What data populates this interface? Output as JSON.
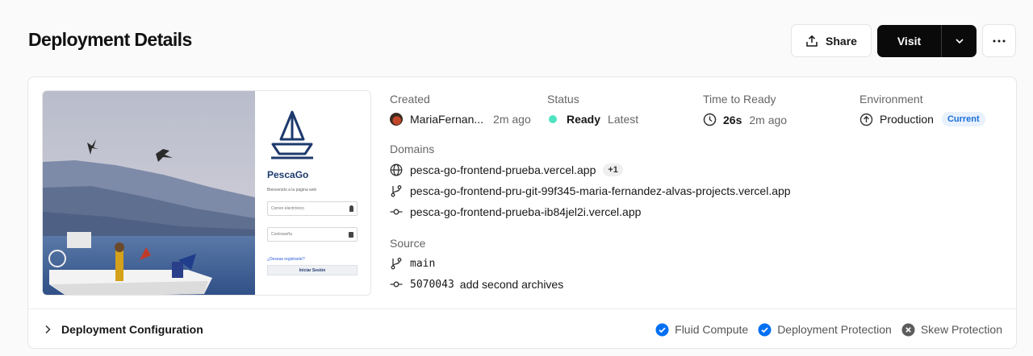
{
  "header": {
    "title": "Deployment Details",
    "share_label": "Share",
    "visit_label": "Visit"
  },
  "preview": {
    "app_name": "PescaGo",
    "welcome": "Bienvenido a la página web",
    "email_placeholder": "Correo electrónico",
    "password_placeholder": "Contraseña",
    "register_link": "¿Deseas registrarte?",
    "login_button": "Iniciar Sesión"
  },
  "info": {
    "created": {
      "label": "Created",
      "user": "MariaFernan...",
      "time": "2m ago"
    },
    "status": {
      "label": "Status",
      "value": "Ready",
      "tag": "Latest",
      "color": "#50e3c2"
    },
    "ready": {
      "label": "Time to Ready",
      "duration": "26s",
      "time": "2m ago"
    },
    "environment": {
      "label": "Environment",
      "value": "Production",
      "badge": "Current"
    }
  },
  "domains": {
    "label": "Domains",
    "primary": "pesca-go-frontend-prueba.vercel.app",
    "extra_count": "+1",
    "branch_domain": "pesca-go-frontend-pru-git-99f345-maria-fernandez-alvas-projects.vercel.app",
    "commit_domain": "pesca-go-frontend-prueba-ib84jel2i.vercel.app"
  },
  "source": {
    "label": "Source",
    "branch": "main",
    "commit_hash": "5070043",
    "commit_message": "add second archives"
  },
  "footer": {
    "config_label": "Deployment Configuration",
    "features": [
      {
        "label": "Fluid Compute",
        "enabled": true
      },
      {
        "label": "Deployment Protection",
        "enabled": true
      },
      {
        "label": "Skew Protection",
        "enabled": false
      }
    ]
  },
  "colors": {
    "accent": "#0070f3",
    "status_ready": "#50e3c2",
    "primary_button": "#0a0a0a"
  }
}
